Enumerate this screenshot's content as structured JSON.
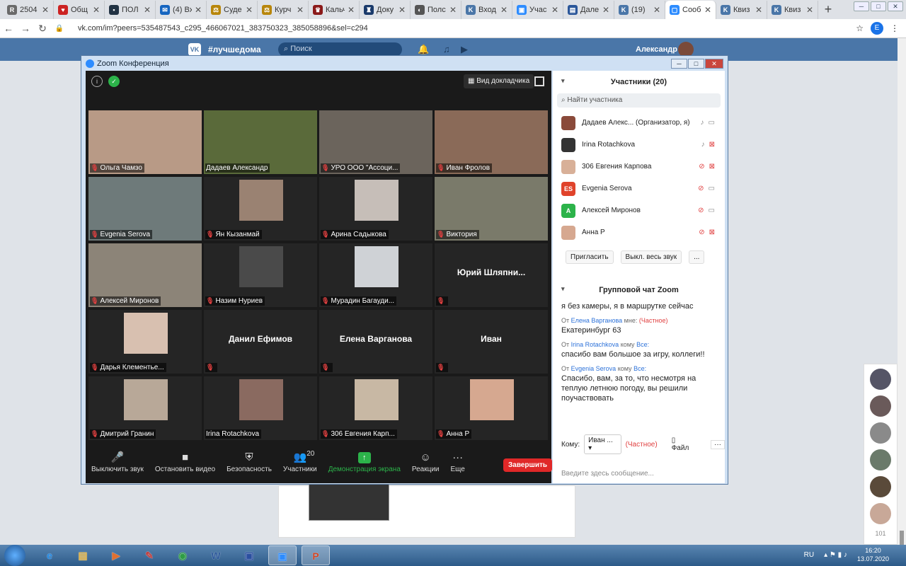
{
  "browser": {
    "tabs": [
      {
        "label": "2504",
        "color": "#6a6a6a",
        "glyph": "R"
      },
      {
        "label": "Общ",
        "color": "#c22",
        "glyph": "♥"
      },
      {
        "label": "ПОЛ",
        "color": "#234",
        "glyph": "▪"
      },
      {
        "label": "(4) Вх",
        "color": "#1565c0",
        "glyph": "✉"
      },
      {
        "label": "Суде",
        "color": "#b8860b",
        "glyph": "⚖"
      },
      {
        "label": "Курч",
        "color": "#b8860b",
        "glyph": "⚖"
      },
      {
        "label": "Кальч",
        "color": "#8b1a1a",
        "glyph": "♛"
      },
      {
        "label": "Доку",
        "color": "#1a3a6b",
        "glyph": "♜"
      },
      {
        "label": "Полс",
        "color": "#555",
        "glyph": "◐"
      },
      {
        "label": "Вход",
        "color": "#4a76a8",
        "glyph": "K"
      },
      {
        "label": "Учас",
        "color": "#2d8cff",
        "glyph": "▣"
      },
      {
        "label": "Дале",
        "color": "#2b579a",
        "glyph": "▤"
      },
      {
        "label": "(19)",
        "color": "#4a76a8",
        "glyph": "K"
      },
      {
        "label": "Сооб",
        "color": "#2d8cff",
        "glyph": "▢",
        "active": true
      },
      {
        "label": "Квиз",
        "color": "#4a76a8",
        "glyph": "K"
      },
      {
        "label": "Квиз",
        "color": "#4a76a8",
        "glyph": "K"
      }
    ],
    "url": "vk.com/im?peers=535487543_c295_466067021_383750323_385058896&sel=c294",
    "profile_initial": "E"
  },
  "vk": {
    "hashtag": "#лучшедома",
    "search_placeholder": "Поиск",
    "user_name": "Александр",
    "side_count": "101"
  },
  "zoom": {
    "window_title": "Zoom Конференция",
    "speaker_view": "Вид докладчика",
    "tiles": [
      {
        "name": "Ольга Чамзо",
        "photo": "#b89a86",
        "mode": "full",
        "muted": true
      },
      {
        "name": "Дадаев Александр",
        "photo": "#5a6a3a",
        "mode": "full",
        "muted": false,
        "active": true
      },
      {
        "name": "УРО ООО \"Ассоци...",
        "photo": "#6b645c",
        "mode": "full",
        "muted": true
      },
      {
        "name": "Иван Фролов",
        "photo": "#8a6a58",
        "mode": "full",
        "muted": true
      },
      {
        "name": "Evgenia Serova",
        "photo": "#6e7a7a",
        "mode": "full",
        "muted": true
      },
      {
        "name": "Ян Кызанмай",
        "photo": "#9a8272",
        "mode": "sq",
        "muted": true
      },
      {
        "name": "Арина Садыкова",
        "photo": "#c6beb8",
        "mode": "sq",
        "muted": true
      },
      {
        "name": "Виктория",
        "photo": "#7a7a6a",
        "mode": "full",
        "muted": true
      },
      {
        "name": "Алексей Миронов",
        "photo": "#8c8478",
        "mode": "full",
        "muted": true
      },
      {
        "name": "Назим Нуриев",
        "photo": "#4a4a4a",
        "mode": "sq",
        "muted": true
      },
      {
        "name": "Мурадин Багауди...",
        "photo": "#cfd2d6",
        "mode": "sq",
        "muted": true
      },
      {
        "name": "",
        "bigname": "Юрий Шляпни...",
        "muted": true
      },
      {
        "name": "Дарья Клементье...",
        "photo": "#d8c0b0",
        "mode": "sq",
        "muted": true
      },
      {
        "name": "",
        "bigname": "Данил Ефимов",
        "muted": true
      },
      {
        "name": "",
        "bigname": "Елена Варганова",
        "muted": true
      },
      {
        "name": "",
        "bigname": "Иван",
        "muted": true
      },
      {
        "name": "Дмитрий Гранин",
        "photo": "#b8a898",
        "mode": "sq",
        "muted": true
      },
      {
        "name": "Irina Rotachkova",
        "photo": "#8a6a60",
        "mode": "sq",
        "muted": false
      },
      {
        "name": "306 Евгения Карп...",
        "photo": "#c8b8a4",
        "mode": "sq",
        "muted": true
      },
      {
        "name": "Анна Р",
        "photo": "#d6a890",
        "mode": "sq",
        "muted": true
      }
    ],
    "toolbar": [
      {
        "label": "Выключить звук",
        "icon": "🎤",
        "name": "mute-audio-button",
        "icon_name": "microphone-icon"
      },
      {
        "label": "Остановить видео",
        "icon": "■",
        "name": "stop-video-button",
        "icon_name": "camera-icon"
      },
      {
        "label": "Безопасность",
        "icon": "⛨",
        "name": "security-button",
        "icon_name": "shield-icon"
      },
      {
        "label": "Участники",
        "icon": "👥",
        "badge": "20",
        "name": "participants-button",
        "icon_name": "people-icon"
      },
      {
        "label": "Демонстрация экрана",
        "icon": "↑",
        "name": "share-screen-button",
        "icon_name": "share-screen-icon",
        "green": true
      },
      {
        "label": "Реакции",
        "icon": "☺",
        "name": "reactions-button",
        "icon_name": "smile-icon"
      },
      {
        "label": "Еще",
        "icon": "···",
        "name": "more-button",
        "icon_name": "more-icon"
      }
    ],
    "end_label": "Завершить"
  },
  "participants_panel": {
    "title": "Участники (20)",
    "search_placeholder": "Найти участника",
    "list": [
      {
        "name": "Дадаев Алекс... (Организатор, я)",
        "avatar": "#8a4a3a",
        "initial": "",
        "mic": "on",
        "cam": "on"
      },
      {
        "name": "Irina Rotachkova",
        "avatar": "#333",
        "initial": "",
        "mic": "on",
        "cam": "off"
      },
      {
        "name": "306 Евгения Карпова",
        "avatar": "#d8b098",
        "initial": "",
        "mic": "off",
        "cam": "off"
      },
      {
        "name": "Evgenia Serova",
        "avatar": "#e0432b",
        "initial": "ES",
        "mic": "off",
        "cam": "on"
      },
      {
        "name": "Алексей Миронов",
        "avatar": "#2cb34a",
        "initial": "A",
        "mic": "off",
        "cam": "on"
      },
      {
        "name": "Анна Р",
        "avatar": "#d6a890",
        "initial": "",
        "mic": "off",
        "cam": "off"
      }
    ],
    "invite_label": "Пригласить",
    "mute_all_label": "Выкл. весь звук",
    "more_label": "..."
  },
  "chat": {
    "title": "Групповой чат Zoom",
    "messages": [
      {
        "from": "",
        "text": "я без камеры, я в маршрутке сейчас"
      },
      {
        "from": "Елена Варганова",
        "to": "мне:",
        "private": "(Частное)",
        "text": "Екатеринбург 63"
      },
      {
        "from": "Irina Rotachkova",
        "to": "кому",
        "to_who": "Все:",
        "text": "спасибо вам большое за игру, коллеги!!"
      },
      {
        "from": "Evgenia Serova",
        "to": "кому",
        "to_who": "Все:",
        "text": "Спасибо, вам, за то, что несмотря на теплую летнюю погоду, вы решили поучаствовать"
      }
    ],
    "from_word": "От",
    "to_label": "Кому:",
    "to_value": "Иван ...",
    "private_label": "(Частное)",
    "file_label": "Файл",
    "more": "···",
    "input_placeholder": "Введите здесь сообщение..."
  },
  "taskbar": {
    "apps": [
      {
        "name": "ie",
        "glyph": "e",
        "color": "#1e88e5"
      },
      {
        "name": "explorer",
        "glyph": "▤",
        "color": "#e0b040"
      },
      {
        "name": "media",
        "glyph": "▶",
        "color": "#e07030"
      },
      {
        "name": "tools",
        "glyph": "✎",
        "color": "#c04040"
      },
      {
        "name": "chrome",
        "glyph": "◉",
        "color": "#2e9d44"
      },
      {
        "name": "word",
        "glyph": "W",
        "color": "#2b579a"
      },
      {
        "name": "save",
        "glyph": "▣",
        "color": "#2b4fa0"
      },
      {
        "name": "zoom",
        "glyph": "▣",
        "color": "#2d8cff",
        "active": true
      },
      {
        "name": "powerpoint",
        "glyph": "P",
        "color": "#d04423",
        "active": true
      }
    ],
    "lang": "RU",
    "time": "16:20",
    "date": "13.07.2020"
  }
}
